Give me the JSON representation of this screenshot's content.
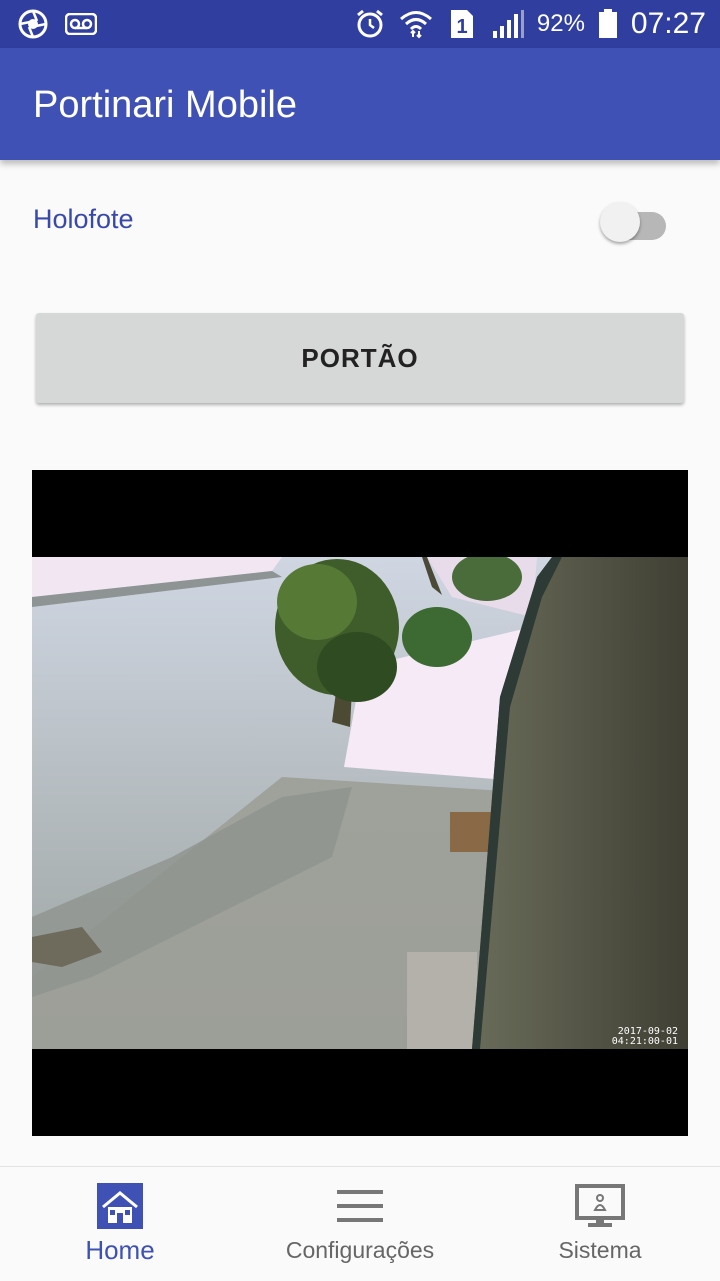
{
  "status_bar": {
    "icons_left": [
      "shutter-icon",
      "voicemail-icon"
    ],
    "icons_right": [
      "alarm-icon",
      "wifi-icon",
      "sim-1-icon",
      "signal-icon",
      "battery-icon"
    ],
    "sim_label": "1",
    "battery_percent": "92%",
    "time": "07:27"
  },
  "app_bar": {
    "title": "Portinari Mobile"
  },
  "controls": {
    "floodlight": {
      "label": "Holofote",
      "checked": false
    },
    "gate_button": {
      "label": "PORTÃO"
    }
  },
  "camera": {
    "timestamp_date": "2017-09-02",
    "timestamp_time": "04:21:00-01"
  },
  "bottom_nav": {
    "items": [
      {
        "label": "Home",
        "icon": "home-icon",
        "active": true
      },
      {
        "label": "Configurações",
        "icon": "menu-icon",
        "active": false
      },
      {
        "label": "Sistema",
        "icon": "monitor-icon",
        "active": false
      }
    ]
  },
  "colors": {
    "status_bar": "#303f9f",
    "app_bar": "#3f51b5",
    "accent": "#3f51b5"
  }
}
